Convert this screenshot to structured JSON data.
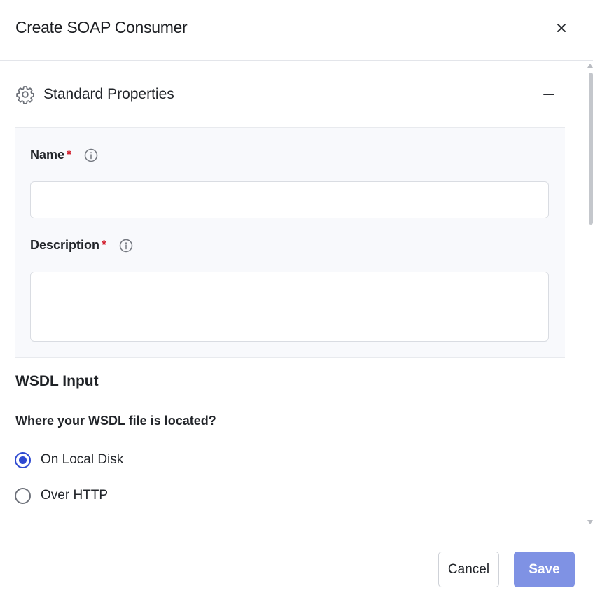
{
  "dialog": {
    "title": "Create SOAP Consumer",
    "close_icon": "close-icon"
  },
  "standard_properties": {
    "title": "Standard Properties",
    "icon": "gear-icon",
    "collapse_icon": "minus-icon",
    "fields": {
      "name": {
        "label": "Name",
        "required_mark": "*",
        "value": "",
        "placeholder": ""
      },
      "description": {
        "label": "Description",
        "required_mark": "*",
        "value": "",
        "placeholder": ""
      }
    }
  },
  "wsdl_input": {
    "title": "WSDL Input",
    "question": "Where your WSDL file is located?",
    "options": [
      {
        "label": "On Local Disk",
        "selected": true
      },
      {
        "label": "Over HTTP",
        "selected": false
      }
    ]
  },
  "footer": {
    "cancel_label": "Cancel",
    "save_label": "Save"
  },
  "colors": {
    "accent": "#2e49d1",
    "save_button_disabled": "#7f92e4",
    "required": "#d21f2e",
    "panel_background": "#f8f9fc"
  }
}
